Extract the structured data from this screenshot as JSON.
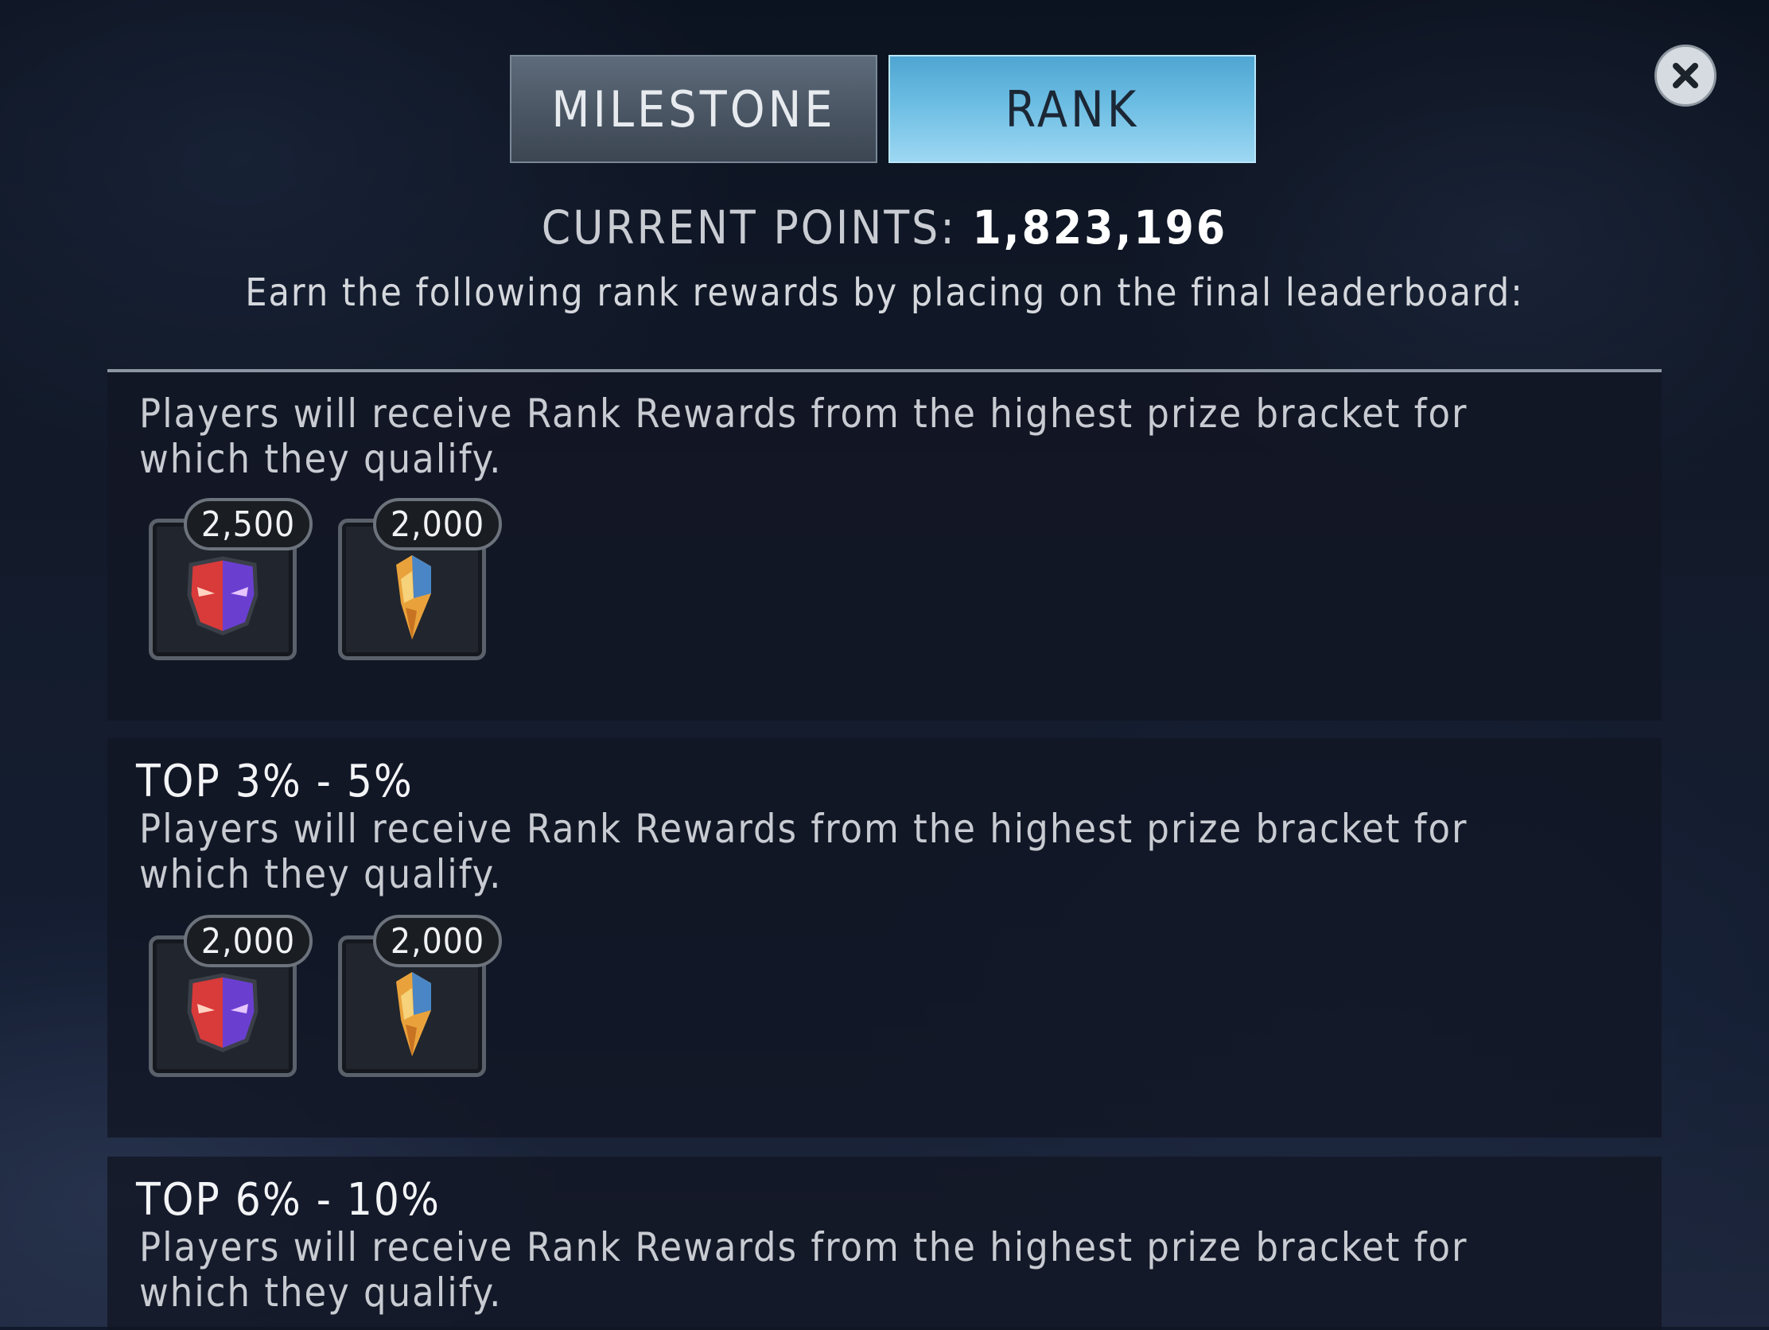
{
  "tabs": {
    "milestone_label": "MILESTONE",
    "rank_label": "RANK",
    "active": "RANK"
  },
  "header": {
    "points_label": "CURRENT POINTS:",
    "points_value": "1,823,196",
    "subtitle": "Earn the following rank rewards by placing on the final leaderboard:"
  },
  "brackets": [
    {
      "title": "",
      "description": "Players will receive Rank Rewards from the highest prize bracket for which they qualify.",
      "rewards": [
        {
          "icon": "faction-emblem-icon",
          "amount": "2,500"
        },
        {
          "icon": "spark-shard-icon",
          "amount": "2,000"
        }
      ]
    },
    {
      "title": "TOP 3% - 5%",
      "description": "Players will receive Rank Rewards from the highest prize bracket for which they qualify.",
      "rewards": [
        {
          "icon": "faction-emblem-icon",
          "amount": "2,000"
        },
        {
          "icon": "spark-shard-icon",
          "amount": "2,000"
        }
      ]
    },
    {
      "title": "TOP 6% - 10%",
      "description": "Players will receive Rank Rewards from the highest prize bracket for which they qualify.",
      "rewards": []
    }
  ],
  "colors": {
    "tab_active": "#6cbde3",
    "tab_inactive": "#4a5563",
    "panel": "#121624"
  }
}
